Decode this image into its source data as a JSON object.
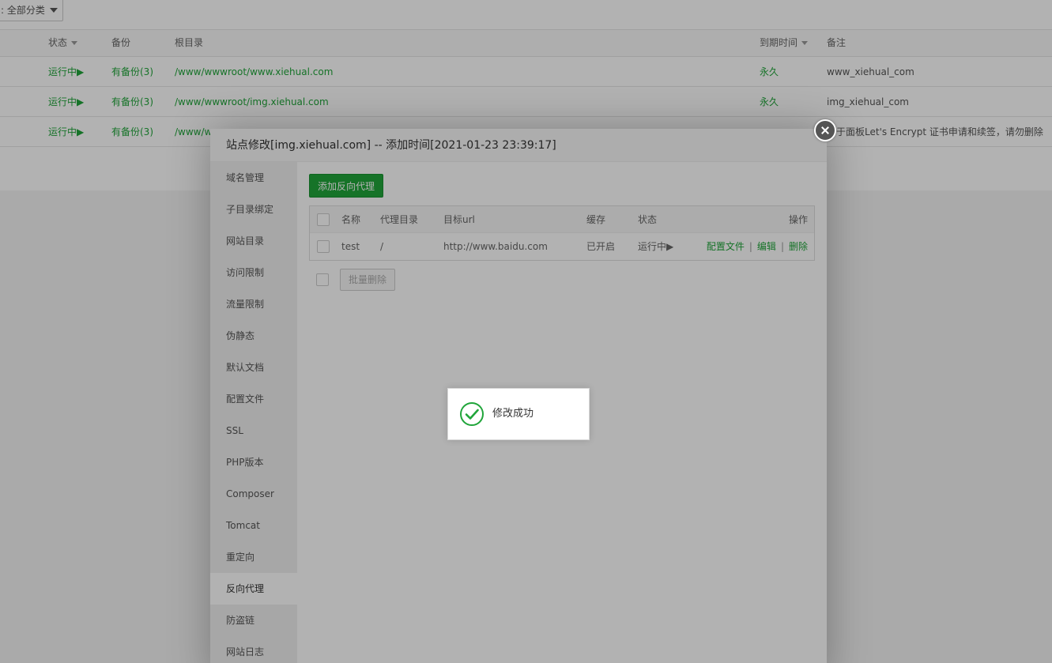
{
  "filter": {
    "label": ": 全部分类"
  },
  "site_table": {
    "headers": {
      "status": "状态",
      "backup": "备份",
      "root": "根目录",
      "expire": "到期时间",
      "note": "备注"
    },
    "rows": [
      {
        "status": "运行中▶",
        "backup": "有备份(3)",
        "root": "/www/wwwroot/www.xiehual.com",
        "expire": "永久",
        "note": "www_xiehual_com"
      },
      {
        "status": "运行中▶",
        "backup": "有备份(3)",
        "root": "/www/wwwroot/img.xiehual.com",
        "expire": "永久",
        "note": "img_xiehual_com"
      },
      {
        "status": "运行中▶",
        "backup": "有备份(3)",
        "root": "/www/w",
        "expire": "",
        "note": "于面板Let's Encrypt 证书申请和续签，请勿删除"
      }
    ]
  },
  "dialog": {
    "title": "站点修改[img.xiehual.com] -- 添加时间[2021-01-23 23:39:17]",
    "menu": [
      "域名管理",
      "子目录绑定",
      "网站目录",
      "访问限制",
      "流量限制",
      "伪静态",
      "默认文档",
      "配置文件",
      "SSL",
      "PHP版本",
      "Composer",
      "Tomcat",
      "重定向",
      "反向代理",
      "防盗链",
      "网站日志"
    ],
    "active_menu": "反向代理",
    "add_button": "添加反向代理",
    "proxy_table": {
      "headers": {
        "name": "名称",
        "dir": "代理目录",
        "url": "目标url",
        "cache": "缓存",
        "status": "状态",
        "ops": "操作"
      },
      "rows": [
        {
          "name": "test",
          "dir": "/",
          "url": "http://www.baidu.com",
          "cache": "已开启",
          "status": "运行中▶",
          "op_config": "配置文件",
          "op_edit": "编辑",
          "op_delete": "删除",
          "sep": "|"
        }
      ]
    },
    "batch_delete": "批量删除"
  },
  "toast": {
    "message": "修改成功"
  },
  "colors": {
    "accent": "#20a53a"
  }
}
